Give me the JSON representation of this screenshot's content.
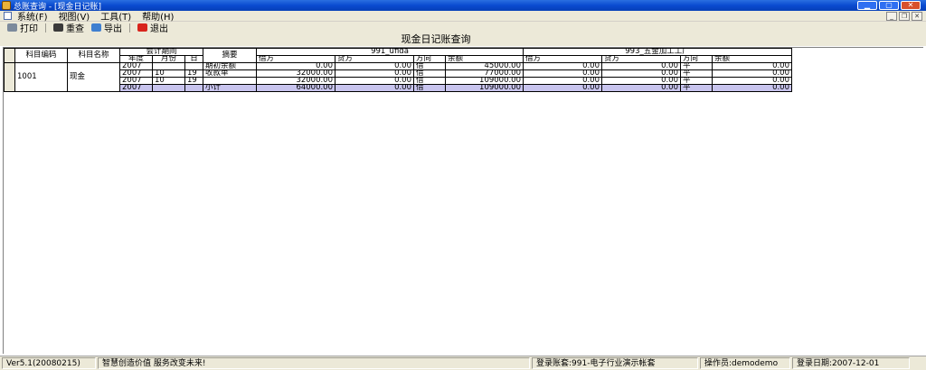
{
  "window": {
    "title": "总账查询 - [现金日记账]",
    "controls": [
      "minimize-icon",
      "maximize-icon",
      "close-icon"
    ]
  },
  "menu": {
    "items": [
      {
        "label": "系统(F)"
      },
      {
        "label": "视图(V)"
      },
      {
        "label": "工具(T)"
      },
      {
        "label": "帮助(H)"
      }
    ]
  },
  "toolbar": {
    "print_label": "打印",
    "requery_label": "重查",
    "export_label": "导出",
    "exit_label": "退出"
  },
  "report": {
    "title": "现金日记账查询"
  },
  "grid": {
    "headers": {
      "subject_code": "科目编码",
      "subject_name": "科目名称",
      "period": "会计期间",
      "summary": "摘要",
      "year": "年度",
      "month": "月份",
      "day": "日",
      "account_a": "991_ufida",
      "account_b": "993_五金加工工厂",
      "debit": "借方",
      "credit": "贷方",
      "direction": "方向",
      "balance": "余额"
    },
    "group": {
      "code": "1001",
      "name": "现金"
    },
    "rows": [
      {
        "year": "2007",
        "month": "",
        "day": "",
        "summary": "期初余额",
        "a_debit": "0.00",
        "a_credit": "0.00",
        "a_dir": "借",
        "a_balance": "45000.00",
        "b_debit": "0.00",
        "b_credit": "0.00",
        "b_dir": "平",
        "b_balance": "0.00"
      },
      {
        "year": "2007",
        "month": "10",
        "day": "19",
        "summary": "收款单",
        "a_debit": "32000.00",
        "a_credit": "0.00",
        "a_dir": "借",
        "a_balance": "77000.00",
        "b_debit": "0.00",
        "b_credit": "0.00",
        "b_dir": "平",
        "b_balance": "0.00"
      },
      {
        "year": "2007",
        "month": "10",
        "day": "19",
        "summary": "",
        "a_debit": "32000.00",
        "a_credit": "0.00",
        "a_dir": "借",
        "a_balance": "109000.00",
        "b_debit": "0.00",
        "b_credit": "0.00",
        "b_dir": "平",
        "b_balance": "0.00"
      },
      {
        "year": "2007",
        "month": "",
        "day": "",
        "summary": "小计",
        "a_debit": "64000.00",
        "a_credit": "0.00",
        "a_dir": "借",
        "a_balance": "109000.00",
        "b_debit": "0.00",
        "b_credit": "0.00",
        "b_dir": "平",
        "b_balance": "0.00"
      }
    ]
  },
  "status": {
    "version": "Ver5.1(20080215)",
    "slogan": "智慧创造价值 服务改变未来!",
    "login_account": "登录账套:991-电子行业演示帐套",
    "operator": "操作员:demodemo",
    "login_date": "登录日期:2007-12-01"
  },
  "colors": {
    "titlebar": "#0a4bd0",
    "chrome": "#ece9d8",
    "selected_row": "#c8c4ee"
  }
}
